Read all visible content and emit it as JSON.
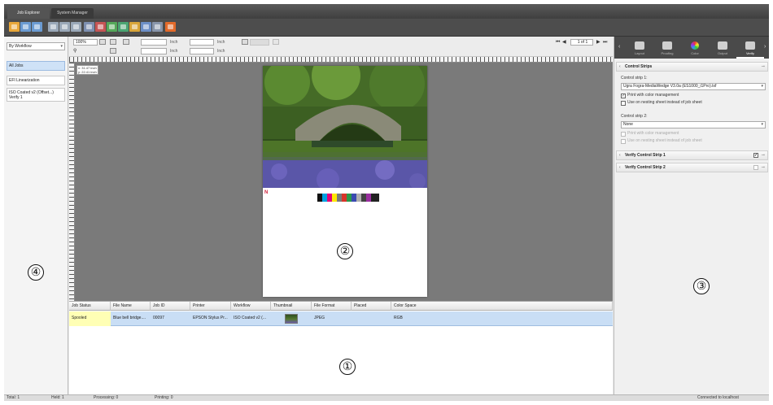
{
  "tabs": [
    {
      "label": "Job Explorer",
      "active": true
    },
    {
      "label": "System Manager",
      "active": false
    }
  ],
  "toolbar": {
    "icons": [
      {
        "name": "open-folder-icon",
        "color": "#e8a73a"
      },
      {
        "name": "import-icon",
        "color": "#6b9bd2"
      },
      {
        "name": "job-list-icon",
        "color": "#6b9bd2"
      },
      {
        "name": "print-icon",
        "color": "#9aa8b8"
      },
      {
        "name": "print-preview-icon",
        "color": "#9aa8b8"
      },
      {
        "name": "print-stop-icon",
        "color": "#9aa8b8"
      },
      {
        "name": "delete-icon",
        "color": "#7d8fb0"
      },
      {
        "name": "duplicate-icon",
        "color": "#c65555"
      },
      {
        "name": "green-layout-icon",
        "color": "#55a85a"
      },
      {
        "name": "color-chart-icon",
        "color": "#4aa572"
      },
      {
        "name": "measure-icon",
        "color": "#d9a53a"
      },
      {
        "name": "report-icon",
        "color": "#6d8fc7"
      },
      {
        "name": "save-icon",
        "color": "#8895aa"
      },
      {
        "name": "cancel-icon",
        "color": "#e36a2a"
      }
    ]
  },
  "left_panel": {
    "workflow_select": "By Workflow",
    "items": [
      {
        "label": "All Jobs",
        "selected": true
      },
      {
        "label": "EFI Linearization",
        "selected": false
      },
      {
        "label": "ISO Coated v2 (Offset...) Verify 1",
        "selected": false
      }
    ],
    "marker": "④"
  },
  "controls": {
    "zoom": "100%",
    "unit1": "Inch",
    "unit2": "Inch",
    "unit3": "Inch",
    "unit4": "Inch",
    "page_indicator": "1 of 1"
  },
  "preview": {
    "coordinates": [
      "x: 31.47 inch",
      "y: 22.41 inch"
    ],
    "marker": "②"
  },
  "jobs_table": {
    "columns": [
      "Job Status",
      "File Name",
      "Job ID",
      "Printer",
      "Workflow",
      "Thumbnail",
      "File Format",
      "Placed",
      "Color Space"
    ],
    "rows": [
      {
        "status": "Spooled",
        "file_name": "Blue bell bridge....",
        "job_id": "00097",
        "printer": "EPSON Stylus Pr...",
        "workflow": "ISO Coated v2 (...",
        "file_format": "JPEG",
        "placed": "",
        "color_space": "RGB"
      }
    ],
    "marker": "①"
  },
  "right_panel": {
    "tabs": [
      {
        "label": "Layout",
        "active": false
      },
      {
        "label": "Proofing",
        "active": false
      },
      {
        "label": "Color",
        "active": false
      },
      {
        "label": "Output",
        "active": false
      },
      {
        "label": "Verify",
        "active": true
      }
    ],
    "section_title": "Control Strips",
    "strip1_label": "Control strip 1:",
    "strip1_value": "Ugra Fogra-MediaWedge V3.0a (ES1000_i1Pro).txf",
    "strip1_opt1": "Print with color management",
    "strip1_opt1_checked": true,
    "strip1_opt2": "Use on nesting sheet instead of job sheet",
    "strip1_opt2_checked": false,
    "strip2_label": "Control strip 2:",
    "strip2_value": "None",
    "strip2_opt1": "Print with color management",
    "strip2_opt2": "Use on nesting sheet instead of job sheet",
    "verify1_title": "Verify Control Strip 1",
    "verify1_checked": true,
    "verify2_title": "Verify Control Strip 2",
    "verify2_checked": false,
    "marker": "③"
  },
  "status_bar": {
    "total": "Total: 1",
    "held": "Held: 1",
    "processing": "Processing: 0",
    "printing": "Printing: 0",
    "connection": "Connected to localhost"
  }
}
